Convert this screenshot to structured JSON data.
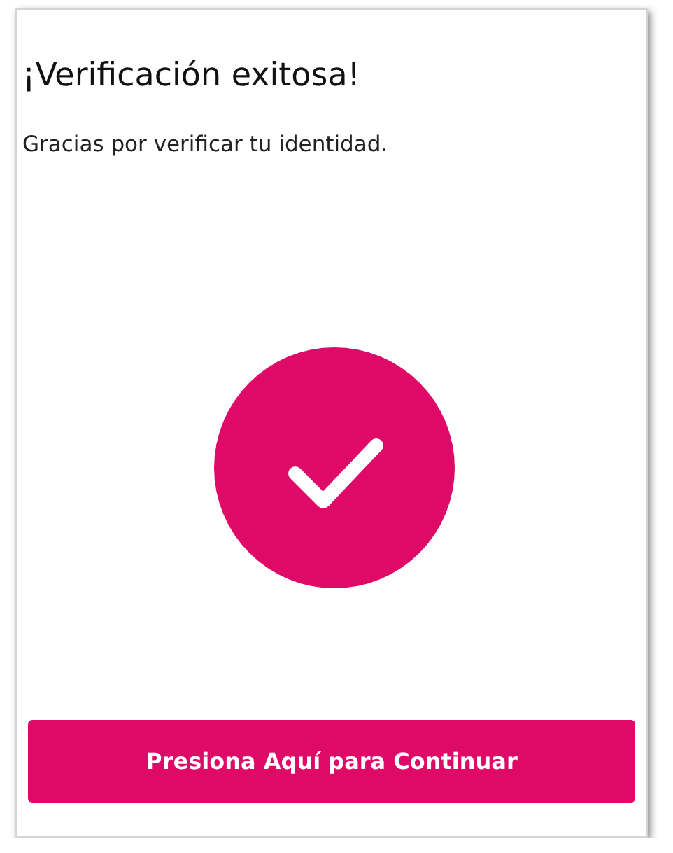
{
  "title": "¡Verificación exitosa!",
  "message": "Gracias por verificar tu identidad.",
  "status": {
    "kind": "success"
  },
  "button": {
    "label": "Presiona Aquí para Continuar"
  }
}
